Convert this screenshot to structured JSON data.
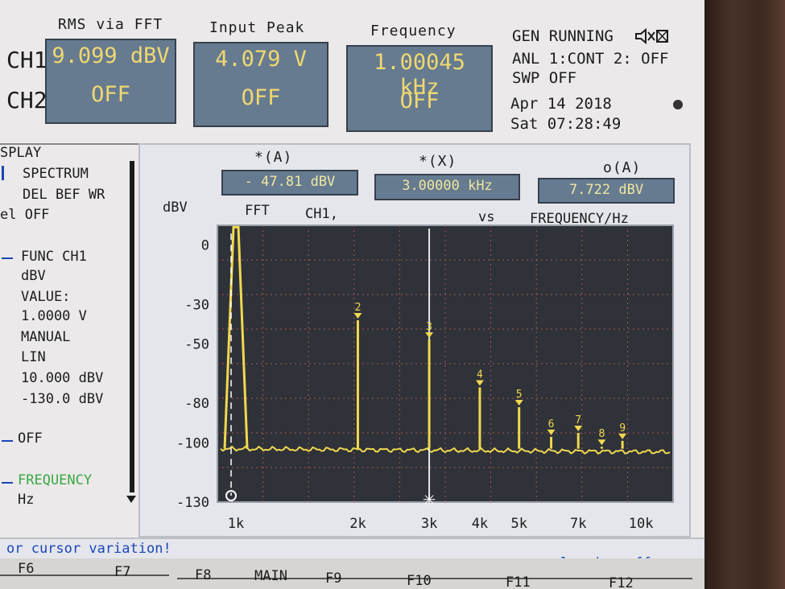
{
  "meters": {
    "rms_header": "RMS via FFT",
    "peak_header": "Input Peak",
    "freq_header": "Frequency",
    "ch1_label": "CH1",
    "ch2_label": "CH2",
    "rms_ch1": "9.099 dBV",
    "rms_ch2": "OFF",
    "peak_ch1": "4.079  V",
    "peak_ch2": "OFF",
    "freq_ch1": "1.00045 kHz",
    "freq_ch2": "OFF"
  },
  "status": {
    "gen": "GEN RUNNING",
    "anl": "ANL 1:CONT 2: OFF",
    "swp": "SWP OFF",
    "date": "Apr 14 2018",
    "time": "Sat 07:28:49"
  },
  "sidebar": {
    "title": "SPLAY",
    "spectrum": "SPECTRUM",
    "delbef": "DEL BEF WR",
    "el_off": "el OFF",
    "func": "FUNC CH1",
    "dbv": "dBV",
    "value_label": "VALUE:",
    "value": "1.0000 V",
    "manual": "MANUAL",
    "lin": "LIN",
    "top": "10.000 dBV",
    "bottom": "-130.0 dBV",
    "off": "OFF",
    "frequency": "FREQUENCY",
    "hz": "Hz"
  },
  "cursors": {
    "a_label": "*(A)",
    "a_value": "- 47.81 dBV",
    "x_label": "*(X)",
    "x_value": "3.00000 kHz",
    "o_label": "o(A)",
    "o_value": "7.722 dBV"
  },
  "plot_header": {
    "unit": "dBV",
    "fft": "FFT",
    "ch": "CH1,",
    "vs": "vs",
    "xaxis": "FREQUENCY/Hz"
  },
  "footer": {
    "message": "or cursor variation!",
    "logging": "logging off",
    "f6": "F6",
    "f7": "F7",
    "f8": "F8",
    "main": "MAIN",
    "f9": "F9",
    "f10": "F10",
    "f11": "F11",
    "f12": "F12"
  },
  "colors": {
    "trace": "#f0d850",
    "plot_bg": "#2f3238",
    "grid": "#c06060",
    "accent_green": "#3aa844",
    "accent_blue": "#1b46b8"
  },
  "chart_data": {
    "type": "line",
    "title": "FFT CH1, vs FREQUENCY/Hz",
    "xlabel": "FREQUENCY/Hz",
    "ylabel": "dBV",
    "xscale": "log",
    "xlim": [
      900,
      12000
    ],
    "ylim": [
      -130,
      10
    ],
    "xticks": [
      {
        "label": "1k",
        "value": 1000
      },
      {
        "label": "2k",
        "value": 2000
      },
      {
        "label": "3k",
        "value": 3000
      },
      {
        "label": "4k",
        "value": 4000
      },
      {
        "label": "5k",
        "value": 5000
      },
      {
        "label": "7k",
        "value": 7000
      },
      {
        "label": "10k",
        "value": 10000
      }
    ],
    "yticks": [
      0,
      -30,
      -50,
      -80,
      -100,
      -130
    ],
    "noise_floor": -103,
    "peaks": [
      {
        "label": "",
        "freq": 1000,
        "dbv": 9.1
      },
      {
        "label": "2",
        "freq": 2000,
        "dbv": -38
      },
      {
        "label": "3",
        "freq": 3000,
        "dbv": -47.8
      },
      {
        "label": "4",
        "freq": 4000,
        "dbv": -72
      },
      {
        "label": "5",
        "freq": 5000,
        "dbv": -82
      },
      {
        "label": "6",
        "freq": 6000,
        "dbv": -97
      },
      {
        "label": "7",
        "freq": 7000,
        "dbv": -95
      },
      {
        "label": "8",
        "freq": 8000,
        "dbv": -102
      },
      {
        "label": "9",
        "freq": 9000,
        "dbv": -99
      }
    ],
    "cursor_x": 3000,
    "grid": true
  }
}
